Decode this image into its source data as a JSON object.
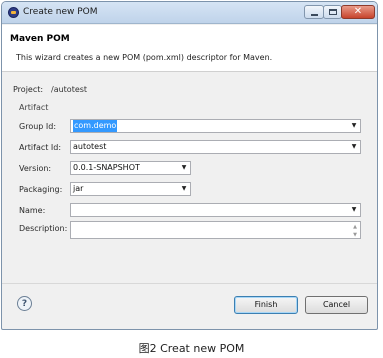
{
  "window": {
    "title": "Create new POM"
  },
  "banner": {
    "title": "Maven POM",
    "description": "This wizard creates a new POM (pom.xml) descriptor for Maven."
  },
  "project": {
    "label": "Project:",
    "value": "/autotest"
  },
  "artifact": {
    "group_label": "Artifact",
    "group_id": {
      "label": "Group Id:",
      "value": "com.demo"
    },
    "artifact_id": {
      "label": "Artifact Id:",
      "value": "autotest"
    },
    "version": {
      "label": "Version:",
      "value": "0.0.1-SNAPSHOT"
    },
    "packaging": {
      "label": "Packaging:",
      "value": "jar"
    },
    "name": {
      "label": "Name:",
      "value": ""
    },
    "description": {
      "label": "Description:",
      "value": ""
    }
  },
  "buttons": {
    "finish": "Finish",
    "cancel": "Cancel"
  },
  "caption": "图2 Creat new POM"
}
